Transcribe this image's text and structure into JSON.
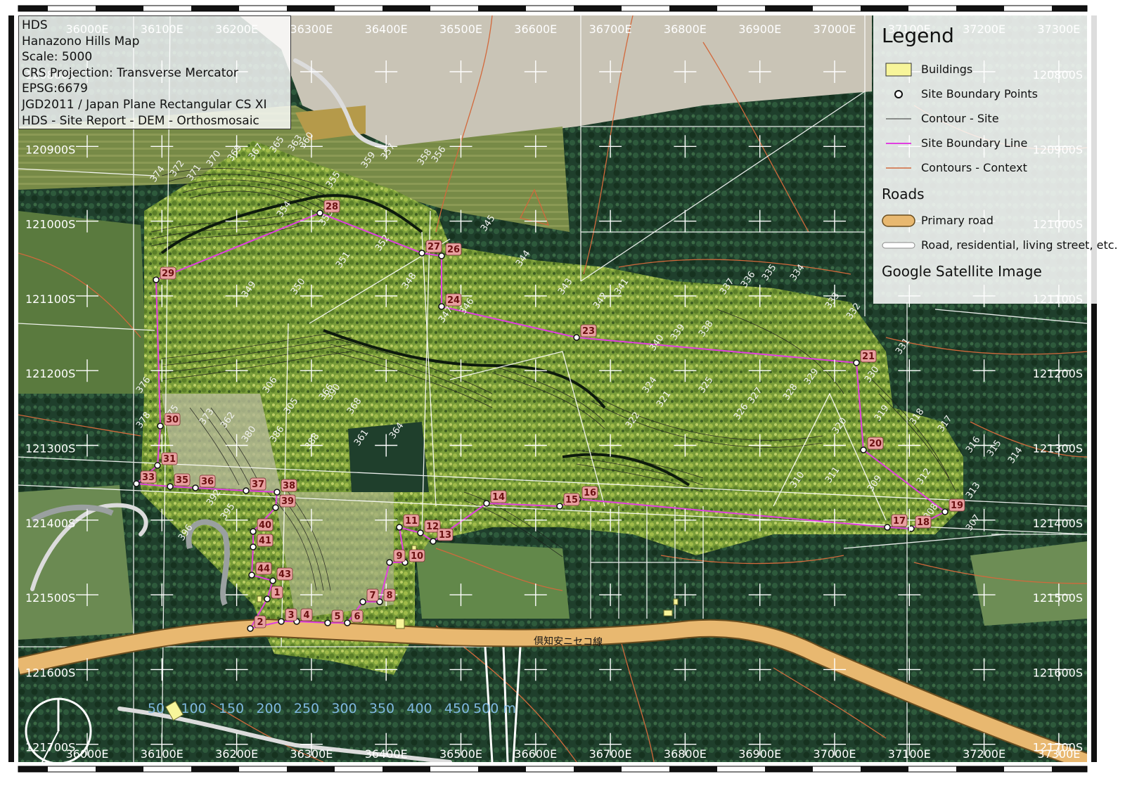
{
  "title_box": {
    "lines": [
      "HDS",
      "Hanazono Hills Map",
      "Scale: 5000",
      "CRS Projection: Transverse Mercator",
      "EPSG:6679",
      "JGD2011 / Japan Plane Rectangular CS XI",
      "HDS - Site Report - DEM - Orthosmosaic"
    ]
  },
  "legend": {
    "title": "Legend",
    "items": [
      {
        "label": "Buildings",
        "symbol": "yellow-box",
        "color": "#f7f59a"
      },
      {
        "label": "Site Boundary Points",
        "symbol": "circle-point"
      },
      {
        "label": "Contour - Site",
        "symbol": "thin-black-line",
        "color": "#333333"
      },
      {
        "label": "Site Boundary Line",
        "symbol": "magenta-line",
        "color": "#e040e0"
      },
      {
        "label": "Contours - Context",
        "symbol": "orange-line",
        "color": "#d2693c"
      }
    ],
    "roads_heading": "Roads",
    "road_items": [
      {
        "label": "Primary road",
        "symbol": "thick-orange-road",
        "color": "#e8b870"
      },
      {
        "label": "Road, residential, living street, etc.",
        "symbol": "white-road"
      }
    ],
    "basemap_label": "Google Satellite Image"
  },
  "grid": {
    "easting_labels": [
      "36000E",
      "36100E",
      "36200E",
      "36300E",
      "36400E",
      "36500E",
      "36600E",
      "36700E",
      "36800E",
      "36900E",
      "37000E",
      "37100E",
      "37200E",
      "37300E"
    ],
    "northing_labels": [
      "120800S",
      "120900S",
      "121000S",
      "121100S",
      "121200S",
      "121300S",
      "121400S",
      "121500S",
      "121600S",
      "121700S"
    ]
  },
  "road_label": "倶知安ニセコ線",
  "scale_bar": {
    "labels": [
      "50",
      "100",
      "150",
      "200",
      "250",
      "300",
      "350",
      "400",
      "450",
      "500 m"
    ]
  },
  "boundary_point_labels": [
    "1",
    "2",
    "3",
    "4",
    "5",
    "6",
    "7",
    "8",
    "9",
    "10",
    "11",
    "12",
    "13",
    "14",
    "15",
    "16",
    "17",
    "18",
    "19",
    "20",
    "21",
    "23",
    "24",
    "26",
    "27",
    "28",
    "29",
    "30",
    "31",
    "33",
    "35",
    "36",
    "37",
    "38",
    "39",
    "40",
    "41",
    "43",
    "44"
  ],
  "contour_labels": [
    "374",
    "372",
    "371",
    "370",
    "369",
    "367",
    "365",
    "363",
    "360",
    "359",
    "357",
    "358",
    "356",
    "355",
    "354",
    "353",
    "352",
    "351",
    "350",
    "349",
    "348",
    "347",
    "346",
    "345",
    "344",
    "343",
    "342",
    "341",
    "340",
    "339",
    "338",
    "337",
    "336",
    "335",
    "334",
    "333",
    "332",
    "331",
    "330",
    "329",
    "328",
    "327",
    "326",
    "325",
    "324",
    "322",
    "321",
    "320",
    "319",
    "318",
    "317",
    "316",
    "315",
    "314",
    "313",
    "312",
    "311",
    "310",
    "309",
    "308",
    "307",
    "306",
    "305",
    "366",
    "368",
    "364",
    "361",
    "362",
    "380",
    "378",
    "376",
    "375",
    "373",
    "386",
    "388",
    "390",
    "392",
    "395",
    "396"
  ],
  "colors": {
    "forest": "#1f3f2c",
    "vegetation": "#7ea23a",
    "field": "#7a8a46",
    "road_primary": "#e8b870",
    "boundary": "#e040e0",
    "boundary_label_bg": "#e8a0a0",
    "context_contour": "#d2693c"
  }
}
